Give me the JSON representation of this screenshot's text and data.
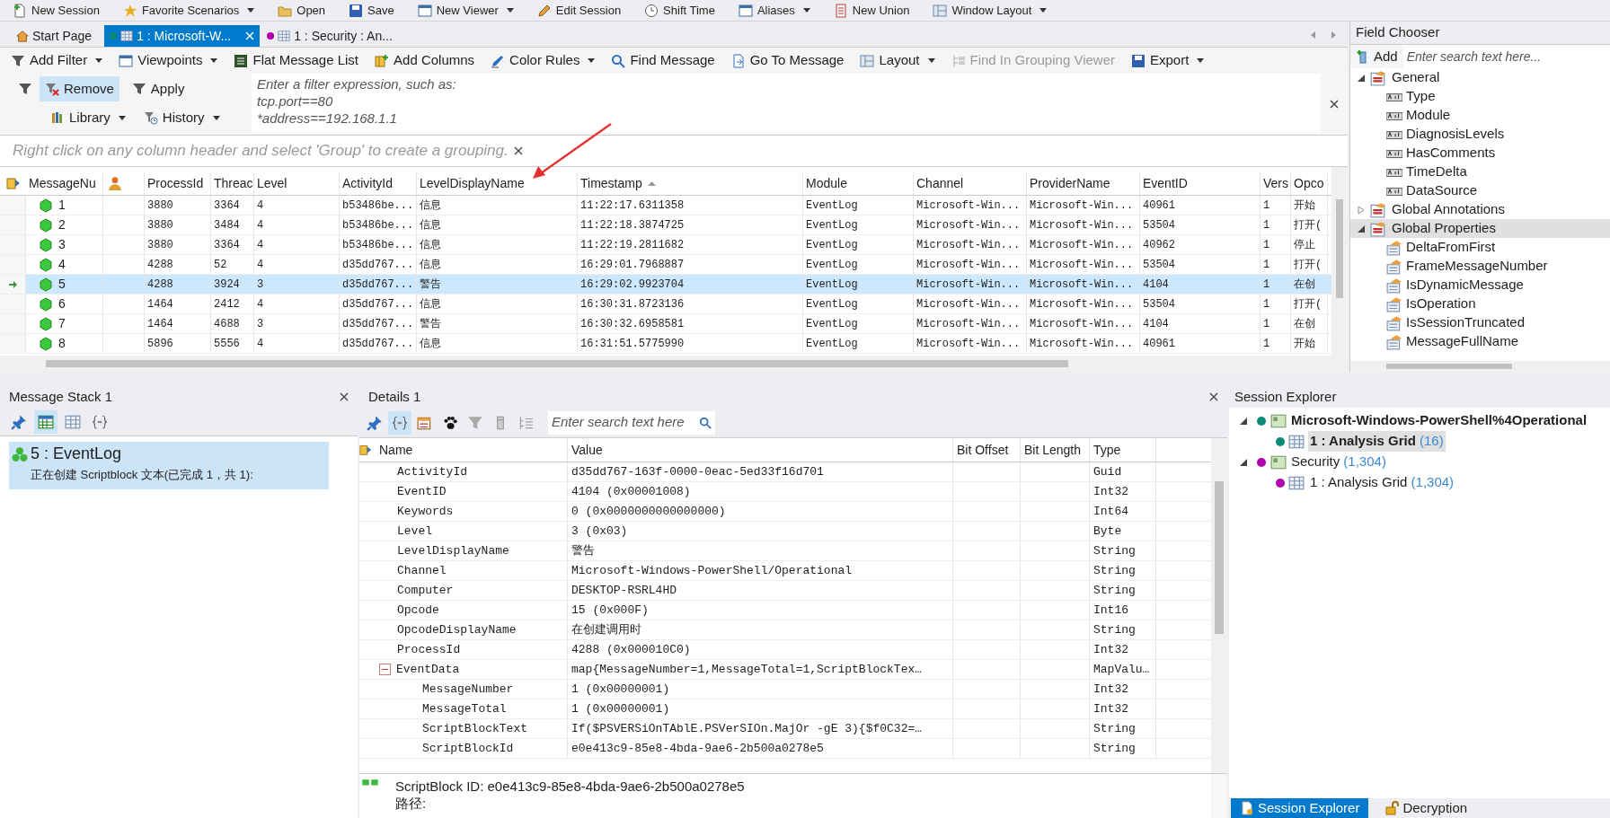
{
  "top_toolbar": [
    {
      "label": "New Session",
      "dropdown": false
    },
    {
      "label": "Favorite Scenarios",
      "dropdown": true
    },
    {
      "label": "Open",
      "dropdown": false
    },
    {
      "label": "Save",
      "dropdown": false
    },
    {
      "label": "New Viewer",
      "dropdown": true
    },
    {
      "label": "Edit Session",
      "dropdown": false
    },
    {
      "label": "Shift Time",
      "dropdown": false
    },
    {
      "label": "Aliases",
      "dropdown": true
    },
    {
      "label": "New Union",
      "dropdown": false
    },
    {
      "label": "Window Layout",
      "dropdown": true
    }
  ],
  "tabs": [
    {
      "kind": "home",
      "label": "Start Page",
      "selected": false
    },
    {
      "kind": "view",
      "label": "1 : Microsoft-W...",
      "selected": true,
      "color": "#0d8a78"
    },
    {
      "kind": "view",
      "label": "1 : Security : An...",
      "selected": false,
      "color": "#b000b0"
    }
  ],
  "toolbar": [
    {
      "label": "Add Filter",
      "dropdown": true,
      "disabled": false
    },
    {
      "label": "Viewpoints",
      "dropdown": true,
      "disabled": false
    },
    {
      "label": "Flat Message List",
      "dropdown": false,
      "disabled": false
    },
    {
      "label": "Add Columns",
      "dropdown": false,
      "disabled": false
    },
    {
      "label": "Color Rules",
      "dropdown": true,
      "disabled": false
    },
    {
      "label": "Find Message",
      "dropdown": false,
      "disabled": false
    },
    {
      "label": "Go To Message",
      "dropdown": false,
      "disabled": false
    },
    {
      "label": "Layout",
      "dropdown": true,
      "disabled": false
    },
    {
      "label": "Find In Grouping Viewer",
      "dropdown": false,
      "disabled": true
    },
    {
      "label": "Export",
      "dropdown": true,
      "disabled": false
    }
  ],
  "filter": {
    "buttons": [
      {
        "label": "Remove",
        "selected": true,
        "dropdown": false
      },
      {
        "label": "Apply",
        "selected": false,
        "dropdown": false
      },
      {
        "label": "Library",
        "selected": false,
        "dropdown": true
      },
      {
        "label": "History",
        "selected": false,
        "dropdown": true
      }
    ],
    "placeholder": "Enter a filter expression, such as:\ntcp.port==80\n*address==192.168.1.1"
  },
  "group_hint": "Right click on any column header and select 'Group' to create a grouping.",
  "grid": {
    "columns": [
      {
        "kind": "text",
        "label": "MessageNu"
      },
      {
        "kind": "icon"
      },
      {
        "kind": "text",
        "label": "ProcessId"
      },
      {
        "kind": "text",
        "label": "Threac"
      },
      {
        "kind": "text",
        "label": "Level"
      },
      {
        "kind": "text",
        "label": "ActivityId"
      },
      {
        "kind": "text",
        "label": "LevelDisplayName"
      },
      {
        "kind": "text",
        "label": "Timestamp",
        "sort_ascending": true
      },
      {
        "kind": "text",
        "label": "Module"
      },
      {
        "kind": "text",
        "label": "Channel"
      },
      {
        "kind": "text",
        "label": "ProviderName"
      },
      {
        "kind": "text",
        "label": "EventID"
      },
      {
        "kind": "text",
        "label": "Vers"
      },
      {
        "kind": "text",
        "label": "Opco"
      }
    ],
    "rows": [
      {
        "selected": false,
        "cells": [
          "1",
          "",
          "3880",
          "3364",
          "4",
          "b53486be...",
          "信息",
          "11:22:17.6311358",
          "EventLog",
          "Microsoft-Win...",
          "Microsoft-Win...",
          "40961",
          "1",
          "开始"
        ]
      },
      {
        "selected": false,
        "cells": [
          "2",
          "",
          "3880",
          "3484",
          "4",
          "b53486be...",
          "信息",
          "11:22:18.3874725",
          "EventLog",
          "Microsoft-Win...",
          "Microsoft-Win...",
          "53504",
          "1",
          "打开("
        ]
      },
      {
        "selected": false,
        "cells": [
          "3",
          "",
          "3880",
          "3364",
          "4",
          "b53486be...",
          "信息",
          "11:22:19.2811682",
          "EventLog",
          "Microsoft-Win...",
          "Microsoft-Win...",
          "40962",
          "1",
          "停止"
        ]
      },
      {
        "selected": false,
        "cells": [
          "4",
          "",
          "4288",
          "52",
          "4",
          "d35dd767...",
          "信息",
          "16:29:01.7968887",
          "EventLog",
          "Microsoft-Win...",
          "Microsoft-Win...",
          "53504",
          "1",
          "打开("
        ]
      },
      {
        "selected": true,
        "cells": [
          "5",
          "",
          "4288",
          "3924",
          "3",
          "d35dd767...",
          "警告",
          "16:29:02.9923704",
          "EventLog",
          "Microsoft-Win...",
          "Microsoft-Win...",
          "4104",
          "1",
          "在创"
        ]
      },
      {
        "selected": false,
        "cells": [
          "6",
          "",
          "1464",
          "2412",
          "4",
          "d35dd767...",
          "信息",
          "16:30:31.8723136",
          "EventLog",
          "Microsoft-Win...",
          "Microsoft-Win...",
          "53504",
          "1",
          "打开("
        ]
      },
      {
        "selected": false,
        "cells": [
          "7",
          "",
          "1464",
          "4688",
          "3",
          "d35dd767...",
          "警告",
          "16:30:32.6958581",
          "EventLog",
          "Microsoft-Win...",
          "Microsoft-Win...",
          "4104",
          "1",
          "在创"
        ]
      },
      {
        "selected": false,
        "cells": [
          "8",
          "",
          "5896",
          "5556",
          "4",
          "d35dd767...",
          "信息",
          "16:31:51.5775990",
          "EventLog",
          "Microsoft-Win...",
          "Microsoft-Win...",
          "40961",
          "1",
          "开始"
        ]
      }
    ]
  },
  "field_chooser": {
    "title": "Field Chooser",
    "add_label": "Add",
    "search_placeholder": "Enter search text here...",
    "tree": [
      {
        "label": "General",
        "expanded": true,
        "selected": false,
        "children": [
          {
            "label": "Type"
          },
          {
            "label": "Module"
          },
          {
            "label": "DiagnosisLevels"
          },
          {
            "label": "HasComments"
          },
          {
            "label": "TimeDelta"
          },
          {
            "label": "DataSource"
          }
        ]
      },
      {
        "label": "Global Annotations",
        "expanded": false,
        "selected": false
      },
      {
        "label": "Global Properties",
        "expanded": true,
        "selected": true,
        "children": [
          {
            "label": "DeltaFromFirst"
          },
          {
            "label": "FrameMessageNumber"
          },
          {
            "label": "IsDynamicMessage"
          },
          {
            "label": "IsOperation"
          },
          {
            "label": "IsSessionTruncated"
          },
          {
            "label": "MessageFullName"
          }
        ]
      }
    ]
  },
  "message_stack": {
    "title": "Message Stack 1",
    "toolbar": [
      {
        "selected": false
      },
      {
        "selected": true
      },
      {
        "selected": false
      },
      {
        "selected": false
      }
    ],
    "entries": [
      {
        "title": "5 : EventLog",
        "text": "正在创建 Scriptblock 文本(已完成 1，共 1):",
        "selected": true
      }
    ]
  },
  "details": {
    "title": "Details 1",
    "toolbar": [
      {
        "selected": false
      },
      {
        "selected": true
      },
      {
        "selected": false
      },
      {
        "selected": false
      },
      {
        "selected": false
      },
      {
        "selected": false
      },
      {
        "selected": false
      }
    ],
    "search_placeholder": "Enter search text here",
    "columns": [
      "Name",
      "Value",
      "Bit Offset",
      "Bit Length",
      "Type"
    ],
    "rows": [
      {
        "name": "ActivityId",
        "value": "d35dd767-163f-0000-0eac-5ed33f16d701",
        "type": "Guid"
      },
      {
        "name": "EventID",
        "value": "4104 (0x00001008)",
        "type": "Int32"
      },
      {
        "name": "Keywords",
        "value": "0 (0x0000000000000000)",
        "type": "Int64"
      },
      {
        "name": "Level",
        "value": "3 (0x03)",
        "type": "Byte"
      },
      {
        "name": "LevelDisplayName",
        "value": "警告",
        "type": "String"
      },
      {
        "name": "Channel",
        "value": "Microsoft-Windows-PowerShell/Operational",
        "type": "String"
      },
      {
        "name": "Computer",
        "value": "DESKTOP-RSRL4HD",
        "type": "String"
      },
      {
        "name": "Opcode",
        "value": "15 (0x000F)",
        "type": "Int16"
      },
      {
        "name": "OpcodeDisplayName",
        "value": "在创建调用时",
        "type": "String"
      },
      {
        "name": "ProcessId",
        "value": "4288 (0x000010C0)",
        "type": "Int32"
      },
      {
        "name": "EventData",
        "value": "map{MessageNumber=1,MessageTotal=1,ScriptBlockTex…",
        "type": "MapValu…",
        "expanded": true,
        "children": [
          {
            "name": "MessageNumber",
            "value": "1 (0x00000001)",
            "type": "Int32"
          },
          {
            "name": "MessageTotal",
            "value": "1 (0x00000001)",
            "type": "Int32"
          },
          {
            "name": "ScriptBlockText",
            "value": "If($PSVERSiOnTAblE.PSVerSIOn.MajOr -gE 3){$f0C32=…",
            "type": "String"
          },
          {
            "name": "ScriptBlockId",
            "value": "e0e413c9-85e8-4bda-9ae6-2b500a0278e5",
            "type": "String"
          }
        ]
      }
    ],
    "preview": [
      "ScriptBlock ID: e0e413c9-85e8-4bda-9ae6-2b500a0278e5",
      "路径:"
    ]
  },
  "session_explorer": {
    "title": "Session Explorer",
    "sessions": [
      {
        "label": "Microsoft-Windows-PowerShell%4Operational",
        "active": true,
        "expanded": true,
        "color": "#0d8a78",
        "children": [
          {
            "label": "1 : Analysis Grid",
            "count": "(16)",
            "selected": true,
            "color": "#0d8a78"
          }
        ]
      },
      {
        "label": "Security",
        "count": "(1,304)",
        "active": false,
        "expanded": true,
        "color": "#b000b0",
        "children": [
          {
            "label": "1 : Analysis Grid",
            "count": "(1,304)",
            "selected": false,
            "color": "#b000b0"
          }
        ]
      }
    ],
    "tabs": [
      {
        "label": "Session Explorer",
        "selected": true
      },
      {
        "label": "Decryption",
        "selected": false
      }
    ]
  }
}
